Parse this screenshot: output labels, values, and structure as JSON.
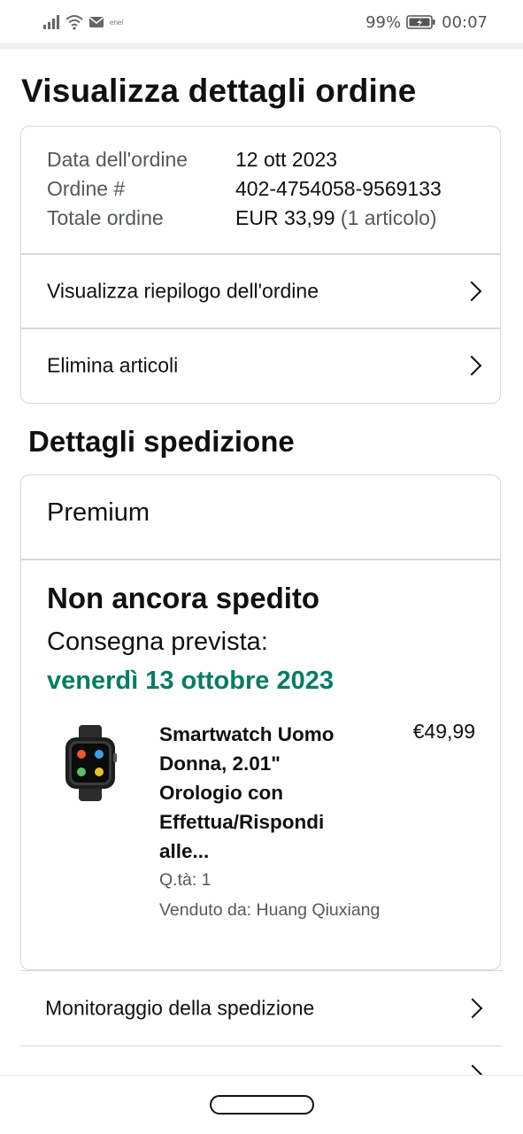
{
  "status_bar": {
    "carrier": "enel",
    "battery": "99%",
    "time": "00:07"
  },
  "page": {
    "title": "Visualizza dettagli ordine"
  },
  "order": {
    "date_label": "Data dell'ordine",
    "date_value": "12 ott 2023",
    "number_label": "Ordine #",
    "number_value": "402-4754058-9569133",
    "total_label": "Totale ordine",
    "total_value": "EUR 33,99",
    "total_items": "(1 articolo)",
    "summary_link": "Visualizza riepilogo dell'ordine",
    "delete_link": "Elimina articoli"
  },
  "shipping": {
    "section_title": "Dettagli spedizione",
    "type": "Premium",
    "status": "Non ancora spedito",
    "delivery_label": "Consegna prevista:",
    "delivery_date": "venerdì 13 ottobre 2023",
    "delivery_color": "#067d62",
    "product": {
      "title": "Smartwatch Uomo Donna, 2.01\" Orologio con Effettua/Rispondi alle...",
      "price": "€49,99",
      "qty": "Q.tà: 1",
      "seller": "Venduto da: Huang Qiuxiang",
      "image": "smartwatch-image"
    }
  },
  "bottom_links": {
    "tracking": "Monitoraggio della spedizione"
  }
}
